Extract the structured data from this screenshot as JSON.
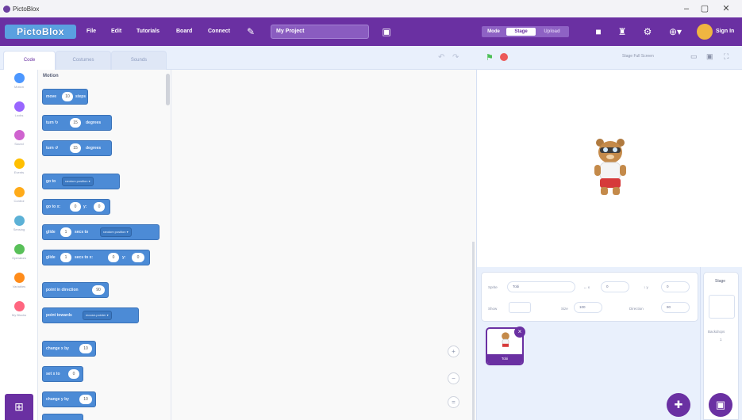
{
  "window": {
    "title": "PictoBlox",
    "minimize": "–",
    "maximize": "▢",
    "close": "✕"
  },
  "menubar": {
    "logo": "PictoBlox",
    "menus": [
      "File",
      "Edit",
      "Tutorials",
      "Board",
      "Connect"
    ],
    "project_name": "My Project",
    "mode_label": "Mode",
    "modes": [
      "Stage",
      "Upload"
    ],
    "sign_in": "Sign In"
  },
  "tabs": [
    {
      "label": "Code"
    },
    {
      "label": "Costumes"
    },
    {
      "label": "Sounds"
    }
  ],
  "stage_header": {
    "fullscreen_label": "Stage Full Screen"
  },
  "categories": [
    {
      "label": "Motion",
      "color": "#4c97ff"
    },
    {
      "label": "Looks",
      "color": "#9966ff"
    },
    {
      "label": "Sound",
      "color": "#cf63cf"
    },
    {
      "label": "Events",
      "color": "#ffbf00"
    },
    {
      "label": "Control",
      "color": "#ffab19"
    },
    {
      "label": "Sensing",
      "color": "#5cb1d6"
    },
    {
      "label": "Operators",
      "color": "#59c059"
    },
    {
      "label": "Variables",
      "color": "#ff8c1a"
    },
    {
      "label": "My Blocks",
      "color": "#ff6680"
    }
  ],
  "palette": {
    "section_title": "Motion",
    "blocks": {
      "move": {
        "pre": "move",
        "value": "10",
        "post": "steps"
      },
      "turn_right": {
        "pre": "turn ↻",
        "value": "15",
        "post": "degrees"
      },
      "turn_left": {
        "pre": "turn ↺",
        "value": "15",
        "post": "degrees"
      },
      "goto": {
        "pre": "go to",
        "dropdown": "random position ▾"
      },
      "goto_xy": {
        "pre": "go to x:",
        "x": "0",
        "mid": "y:",
        "y": "0"
      },
      "glide_to": {
        "pre": "glide",
        "value": "1",
        "mid": "secs to",
        "dropdown": "random position ▾"
      },
      "glide_xy": {
        "pre": "glide",
        "value": "1",
        "mid": "secs to x:",
        "x": "0",
        "mid2": "y:",
        "y": "0"
      },
      "point_dir": {
        "pre": "point in direction",
        "value": "90"
      },
      "point_towards": {
        "pre": "point towards",
        "dropdown": "mouse-pointer ▾"
      },
      "change_x": {
        "pre": "change x by",
        "value": "10"
      },
      "set_x": {
        "pre": "set x to",
        "value": "0"
      },
      "change_y": {
        "pre": "change y by",
        "value": "10"
      }
    }
  },
  "sprite_info": {
    "sprite_label": "Sprite",
    "sprite_name": "Tobi",
    "x_label": "↔ x",
    "x_value": "0",
    "y_label": "↕ y",
    "y_value": "0",
    "show_label": "Show",
    "size_label": "Size",
    "size_value": "100",
    "direction_label": "Direction",
    "direction_value": "90"
  },
  "sprites": [
    {
      "name": "Tobi"
    }
  ],
  "stage_panel": {
    "title": "Stage",
    "backdrops_label": "Backdrops",
    "backdrops_count": "1"
  }
}
